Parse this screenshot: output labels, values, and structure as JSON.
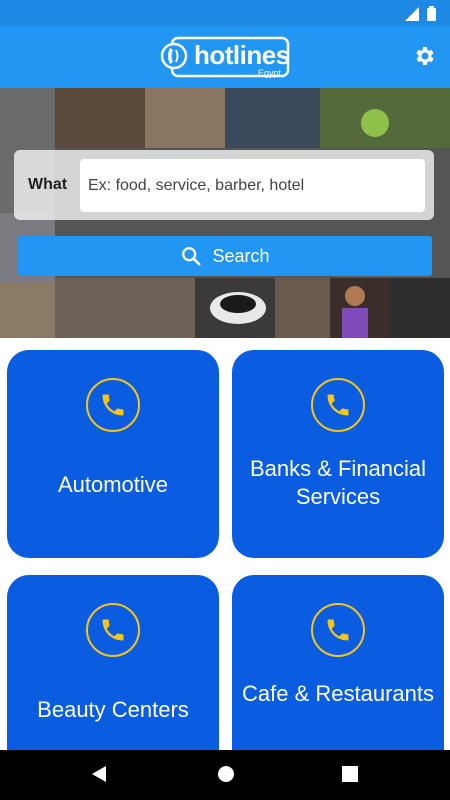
{
  "app": {
    "logo_text": "hotlines",
    "logo_sub": "Egypt"
  },
  "search": {
    "what_label": "What",
    "placeholder": "Ex: food, service, barber, hotel",
    "button_label": "Search"
  },
  "categories": [
    {
      "label": "Automotive"
    },
    {
      "label": "Banks & Financial Services"
    },
    {
      "label": "Beauty Centers"
    },
    {
      "label": "Cafe & Restaurants"
    }
  ],
  "colors": {
    "primary": "#2196f3",
    "status_bar": "#1e88e5",
    "card": "#0a5de0",
    "phone_icon": "#f5c518"
  }
}
